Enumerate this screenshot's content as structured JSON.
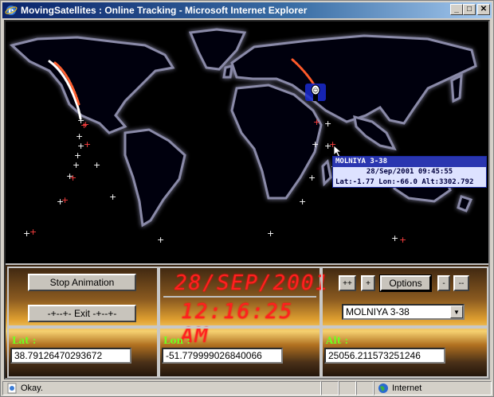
{
  "window": {
    "title": "MovingSatellites : Online Tracking - Microsoft Internet Explorer",
    "min_label": "_",
    "max_label": "□",
    "close_label": "✕"
  },
  "tooltip": {
    "name": "MOLNIYA 3-38",
    "datetime": "28/Sep/2001 09:45:55",
    "coords": "Lat:-1.77 Lon:-66.0 Alt:3302.792"
  },
  "controls": {
    "stop_label": "Stop Animation",
    "exit_label": "-+--+- Exit -+--+-",
    "date_display": "28/SEP/2001",
    "time_display": "12:16:25 AM",
    "plusplus_label": "++",
    "plus_label": "+",
    "options_label": "Options",
    "minus_label": "-",
    "minusminus_label": "--",
    "satellite_selected": "MOLNIYA 3-38"
  },
  "readouts": {
    "lat_label": "Lat :",
    "lat_value": "38.79126470293672",
    "lon_label": "Lon :",
    "lon_value": "-51.779999026840066",
    "alt_label": "Alt :",
    "alt_value": "25056.211573251246"
  },
  "status": {
    "text": "Okay.",
    "zone": "Internet"
  }
}
